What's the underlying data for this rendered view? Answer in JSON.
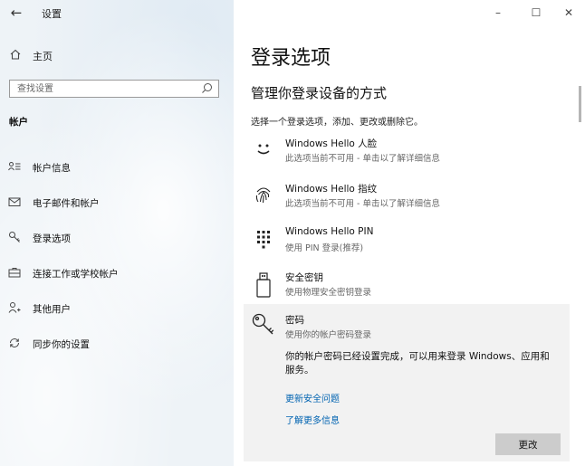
{
  "window": {
    "title": "设置",
    "back_glyph": "←",
    "minimize_glyph": "–",
    "maximize_glyph": "☐",
    "close_glyph": "✕"
  },
  "sidebar": {
    "home_label": "主页",
    "search_placeholder": "查找设置",
    "section_label": "帐户",
    "items": [
      {
        "label": "帐户信息",
        "icon": "person-lines-icon"
      },
      {
        "label": "电子邮件和帐户",
        "icon": "mail-icon"
      },
      {
        "label": "登录选项",
        "icon": "key-icon",
        "selected": true
      },
      {
        "label": "连接工作或学校帐户",
        "icon": "briefcase-icon"
      },
      {
        "label": "其他用户",
        "icon": "person-plus-icon"
      },
      {
        "label": "同步你的设置",
        "icon": "sync-icon"
      }
    ]
  },
  "main": {
    "title": "登录选项",
    "subtitle": "管理你登录设备的方式",
    "description": "选择一个登录选项，添加、更改或删除它。",
    "options": [
      {
        "name": "Windows Hello 人脸",
        "sub": "此选项当前不可用 - 单击以了解详细信息",
        "icon": "face-icon"
      },
      {
        "name": "Windows Hello 指纹",
        "sub": "此选项当前不可用 - 单击以了解详细信息",
        "icon": "fingerprint-icon"
      },
      {
        "name": "Windows Hello PIN",
        "sub": "使用 PIN 登录(推荐)",
        "icon": "pin-keypad-icon"
      },
      {
        "name": "安全密钥",
        "sub": "使用物理安全密钥登录",
        "icon": "usb-key-icon"
      }
    ],
    "password": {
      "name": "密码",
      "sub": "使用你的帐户密码登录",
      "info": "你的帐户密码已经设置完成，可以用来登录 Windows、应用和服务。",
      "link_update": "更新安全问题",
      "link_learn": "了解更多信息",
      "change_label": "更改",
      "icon": "key-icon"
    }
  },
  "colors": {
    "link": "#0063b1",
    "panel_bg": "#f2f2f2",
    "button_bg": "#cccccc",
    "sidebar_bg": "#eef3f7"
  }
}
